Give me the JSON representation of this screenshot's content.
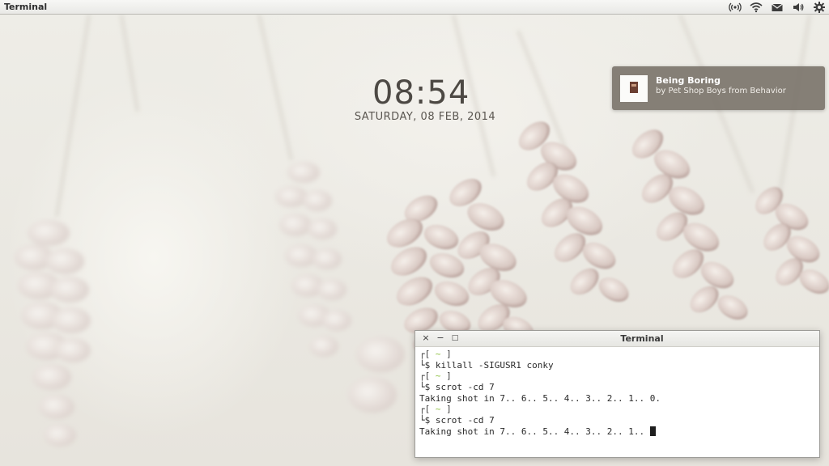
{
  "panel": {
    "app_title": "Terminal",
    "tray_icons": [
      "network-wireless-signal-icon",
      "wifi-icon",
      "mail-icon",
      "volume-icon",
      "settings-gear-icon"
    ]
  },
  "clock": {
    "time": "08:54",
    "date": "SATURDAY, 08 FEB, 2014"
  },
  "notification": {
    "title": "Being Boring",
    "subtitle": "by Pet Shop Boys from Behavior"
  },
  "terminal": {
    "title": "Terminal",
    "buttons": {
      "close": "×",
      "minimize": "−",
      "maximize": "□"
    },
    "prompt_dir": "~",
    "lines": [
      {
        "kind": "prompt_head"
      },
      {
        "kind": "command",
        "text": "$ killall -SIGUSR1 conky"
      },
      {
        "kind": "prompt_head"
      },
      {
        "kind": "command",
        "text": "$ scrot -cd 7"
      },
      {
        "kind": "output",
        "text": "Taking shot in 7.. 6.. 5.. 4.. 3.. 2.. 1.. 0."
      },
      {
        "kind": "prompt_head"
      },
      {
        "kind": "command",
        "text": "$ scrot -cd 7"
      },
      {
        "kind": "output",
        "text": "Taking shot in 7.. 6.. 5.. 4.. 3.. 2.. 1.. ",
        "cursor": true
      }
    ]
  },
  "colors": {
    "prompt_tilde": "#8abf3a",
    "notification_bg": "#767066",
    "clock_text": "#4d4944"
  }
}
